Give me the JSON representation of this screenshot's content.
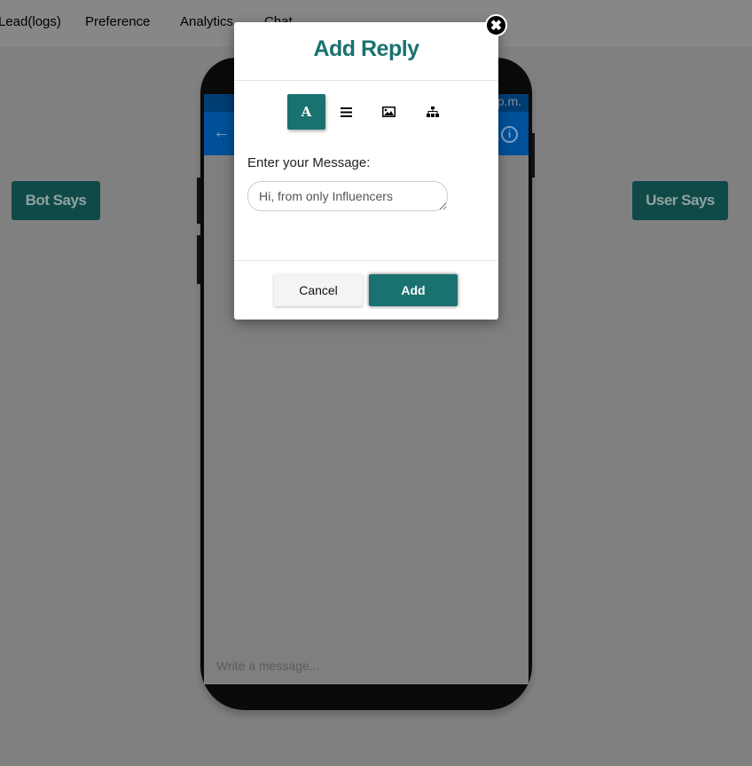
{
  "nav": {
    "items": [
      "Lead(logs)",
      "Preference",
      "Analytics",
      "Chat"
    ]
  },
  "buttons": {
    "bot_says": "Bot Says",
    "user_says": "User Says"
  },
  "phone": {
    "status_time": "p.m.",
    "compose_placeholder": "Write a message..."
  },
  "modal": {
    "title": "Add Reply",
    "tools": [
      "text-icon",
      "list-icon",
      "image-icon",
      "sitemap-icon"
    ],
    "text_tool_glyph": "A",
    "label": "Enter your Message:",
    "message_value": "Hi, from only Influencers",
    "cancel": "Cancel",
    "add": "Add"
  },
  "colors": {
    "accent": "#1a7270",
    "phone_header": "#0068c8"
  }
}
